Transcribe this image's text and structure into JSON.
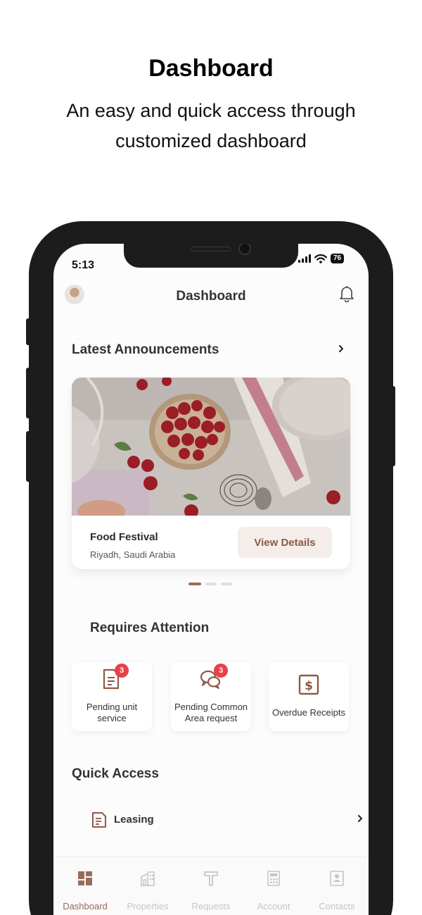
{
  "promo": {
    "title": "Dashboard",
    "subtitle": "An easy and quick access through customized dashboard"
  },
  "status_bar": {
    "time": "5:13",
    "battery": "76"
  },
  "header": {
    "title": "Dashboard",
    "avatar_icon": "user-avatar",
    "notification_icon": "bell-icon"
  },
  "announcements": {
    "title": "Latest Announcements",
    "card": {
      "title": "Food Festival",
      "location": "Riyadh, Saudi Arabia",
      "button_label": "View Details",
      "image": "cherries-bowl-photo"
    },
    "pages": 3,
    "active_page": 1
  },
  "attention": {
    "title": "Requires Attention",
    "items": [
      {
        "label": "Pending unit service",
        "badge": "3",
        "icon": "document-icon"
      },
      {
        "label": "Pending Common Area request",
        "badge": "3",
        "icon": "chat-bubbles-icon"
      },
      {
        "label": "Overdue Receipts",
        "badge": "",
        "icon": "dollar-receipt-icon"
      }
    ]
  },
  "quick_access": {
    "title": "Quick Access",
    "items": [
      {
        "label": "Leasing",
        "icon": "leasing-document-icon"
      }
    ]
  },
  "tabs": [
    {
      "label": "Dashboard",
      "icon": "dashboard-icon",
      "active": true
    },
    {
      "label": "Properties",
      "icon": "building-icon",
      "active": false
    },
    {
      "label": "Requests",
      "icon": "hammer-icon",
      "active": false
    },
    {
      "label": "Account",
      "icon": "calculator-icon",
      "active": false
    },
    {
      "label": "Contacts",
      "icon": "contact-card-icon",
      "active": false
    }
  ],
  "colors": {
    "accent": "#9a6b5a",
    "badge": "#e8414b",
    "tab_inactive": "#c5c5c5"
  }
}
